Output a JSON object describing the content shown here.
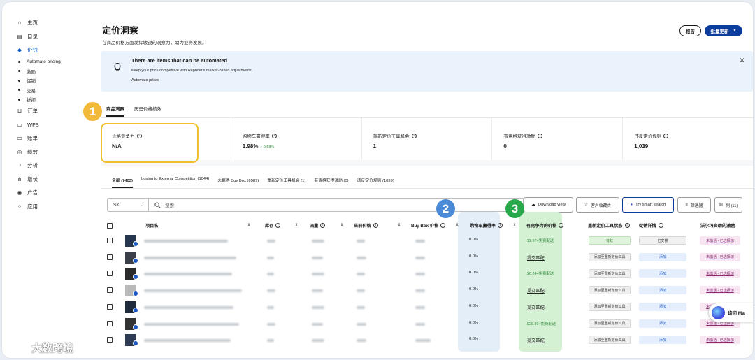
{
  "sidebar": {
    "items": [
      {
        "label": "主页",
        "icon": "home-icon",
        "glyph": "⌂"
      },
      {
        "label": "目录",
        "icon": "catalog-icon",
        "glyph": "▤"
      },
      {
        "label": "价钱",
        "icon": "price-tag-icon",
        "glyph": "◆",
        "active": true
      },
      {
        "label": "订单",
        "icon": "cart-icon",
        "glyph": "⊔"
      },
      {
        "label": "WFS",
        "icon": "truck-icon",
        "glyph": "▭"
      },
      {
        "label": "账单",
        "icon": "billing-icon",
        "glyph": "▭"
      },
      {
        "label": "绩效",
        "icon": "performance-icon",
        "glyph": "◎"
      },
      {
        "label": "分析",
        "icon": "analytics-icon",
        "glyph": "◔"
      },
      {
        "label": "增长",
        "icon": "growth-icon",
        "glyph": "⋔"
      },
      {
        "label": "广告",
        "icon": "ads-icon",
        "glyph": "◉"
      },
      {
        "label": "应用",
        "icon": "apps-icon",
        "glyph": "⁘"
      }
    ],
    "subitems": [
      "Automate pricing",
      "激励",
      "促销",
      "交易",
      "折扣"
    ]
  },
  "header": {
    "title": "定价洞察",
    "subtitle": "在商品价格方面发挥敏锐的洞察力，助力业务发展。",
    "report_label": "报告",
    "bulk_label": "批量更新"
  },
  "banner": {
    "title": "There are items that can be automated",
    "desc": "Keep your price competitive with Repricer's market-based adjustments.",
    "link": "Automate prices",
    "close": "×"
  },
  "tabs1": [
    "商品洞察",
    "历史价格绩效"
  ],
  "metrics": [
    {
      "label": "价格竞争力",
      "value": "N/A",
      "delta": ""
    },
    {
      "label": "购物车赢得率",
      "value": "1.98%",
      "delta": "↑ 0.58%"
    },
    {
      "label": "重新定价工具机会",
      "value": "1",
      "delta": ""
    },
    {
      "label": "有资格获得激励",
      "value": "0",
      "delta": ""
    },
    {
      "label": "违反定价规则",
      "value": "1,039",
      "delta": ""
    }
  ],
  "tabs2": [
    "全部 (7403)",
    "Losing to External Competition (1044)",
    "未赢得 Buy Box (6589)",
    "重新定价工具机会 (1)",
    "有资格获得激励 (0)",
    "违反定价规则 (1039)"
  ],
  "toolbar": {
    "sku_label": "SKU",
    "search_placeholder": "搜索",
    "download_label": "Download view",
    "favorites_label": "客户收藏夹",
    "smart_search_label": "Try smart search",
    "filter_label": "筛选器",
    "columns_label": "列 (11)"
  },
  "table": {
    "headers": {
      "item_name": "项目名",
      "inventory": "库存",
      "traffic": "流量",
      "current_price": "当前价格",
      "buybox_price": "Buy Box 价格",
      "win_rate": "购物车赢得率",
      "competitive_price": "有竞争力的价格",
      "repricer_status": "重新定价工具状态",
      "promo_details": "促销详情",
      "walmart_incentive": "沃尔玛资助的激励"
    },
    "rows": [
      {
        "win": "0.0%",
        "comp": "$2.67+免费配送",
        "comp_link": false,
        "status": "有效",
        "status_kind": "green",
        "promo": "已安排",
        "promo_kind": "gray",
        "incentive": "未激活 - 已选择加"
      },
      {
        "win": "0.0%",
        "comp": "提交匹配",
        "comp_link": true,
        "status": "添加至重新定价工具",
        "status_kind": "gray",
        "promo": "添加",
        "promo_kind": "blue",
        "incentive": "未激活 - 已选择加"
      },
      {
        "win": "0.0%",
        "comp": "$6.24+免费配送",
        "comp_link": false,
        "status": "添加至重新定价工具",
        "status_kind": "gray",
        "promo": "添加",
        "promo_kind": "blue",
        "incentive": "未激活 - 已选择加"
      },
      {
        "win": "0.0%",
        "comp": "提交匹配",
        "comp_link": true,
        "status": "添加至重新定价工具",
        "status_kind": "gray",
        "promo": "添加",
        "promo_kind": "blue",
        "incentive": "未激活 - 已选择加"
      },
      {
        "win": "0.0%",
        "comp": "提交匹配",
        "comp_link": true,
        "status": "添加至重新定价工具",
        "status_kind": "gray",
        "promo": "添加",
        "promo_kind": "blue",
        "incentive": "未激活 - 已选择加"
      },
      {
        "win": "0.0%",
        "comp": "$28.99+免费配送",
        "comp_link": false,
        "status": "添加至重新定价工具",
        "status_kind": "gray",
        "promo": "添加",
        "promo_kind": "blue",
        "incentive": "未激活 - 已选择加"
      },
      {
        "win": "0.0%",
        "comp": "提交匹配",
        "comp_link": true,
        "status": "添加至重新定价工具",
        "status_kind": "gray",
        "promo": "添加",
        "promo_kind": "blue",
        "incentive": "未激活 - 已选择加"
      }
    ]
  },
  "annotations": {
    "one": "1",
    "two": "2",
    "three": "3"
  },
  "chat": {
    "label": "询问 Ma"
  },
  "watermark": {
    "text": "大数跨境"
  },
  "colors": {
    "accent": "#0b3c9e",
    "highlight_yellow": "#f0bf2b",
    "marker_blue": "#4a8ad6",
    "marker_green": "#27a84a",
    "marker_yellow": "#f2b93a"
  }
}
